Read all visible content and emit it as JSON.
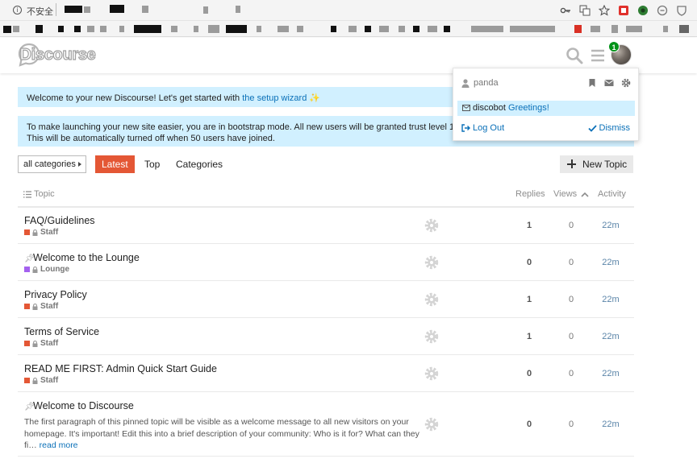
{
  "browser": {
    "security_label": "不安全",
    "info_glyph": "i"
  },
  "header": {
    "logo_text": "Discourse",
    "notification_count": "1"
  },
  "banners": {
    "welcome_text": "Welcome to your new Discourse! Let's get started with ",
    "welcome_link": "the setup wizard",
    "welcome_sparkle": "✨",
    "bootstrap_line1": "To make launching your new site easier, you are in bootstrap mode. All new users will be granted trust level 1 and ha",
    "bootstrap_line2": "This will be automatically turned off when 50 users have joined."
  },
  "nav": {
    "categories_dropdown": "all categories",
    "latest": "Latest",
    "top": "Top",
    "categories": "Categories",
    "new_topic": "New Topic"
  },
  "table": {
    "headers": {
      "topic": "Topic",
      "replies": "Replies",
      "views": "Views",
      "activity": "Activity"
    },
    "rows": [
      {
        "title": "FAQ/Guidelines",
        "category": "Staff",
        "category_color": "#e45735",
        "pinned": false,
        "replies": "1",
        "views": "0",
        "activity": "22m"
      },
      {
        "title": "Welcome to the Lounge",
        "category": "Lounge",
        "category_color": "#a461ef",
        "pinned": true,
        "replies": "0",
        "views": "0",
        "activity": "22m"
      },
      {
        "title": "Privacy Policy",
        "category": "Staff",
        "category_color": "#e45735",
        "pinned": false,
        "replies": "1",
        "views": "0",
        "activity": "22m"
      },
      {
        "title": "Terms of Service",
        "category": "Staff",
        "category_color": "#e45735",
        "pinned": false,
        "replies": "1",
        "views": "0",
        "activity": "22m"
      },
      {
        "title": "READ ME FIRST: Admin Quick Start Guide",
        "category": "Staff",
        "category_color": "#e45735",
        "pinned": false,
        "replies": "0",
        "views": "0",
        "activity": "22m"
      },
      {
        "title": "Welcome to Discourse",
        "category": "",
        "category_color": "",
        "pinned": true,
        "replies": "0",
        "views": "0",
        "activity": "22m",
        "excerpt": "The first paragraph of this pinned topic will be visible as a welcome message to all new visitors on your homepage. It's important! Edit this into a brief description of your community: Who is it for? What can they fi… ",
        "read_more": "read more"
      }
    ]
  },
  "user_menu": {
    "username": "panda",
    "notification_from": "discobot",
    "notification_text": "Greetings!",
    "logout": "Log Out",
    "dismiss": "Dismiss"
  },
  "colors": {
    "accent": "#e45735",
    "link": "#0a70b8",
    "banner_bg": "#d1f0ff",
    "badge_green": "#019218"
  },
  "icons": {
    "header": [
      "search-icon",
      "hamburger-icon"
    ],
    "user_menu": [
      "bookmark-icon",
      "envelope-icon",
      "gear-icon"
    ]
  }
}
